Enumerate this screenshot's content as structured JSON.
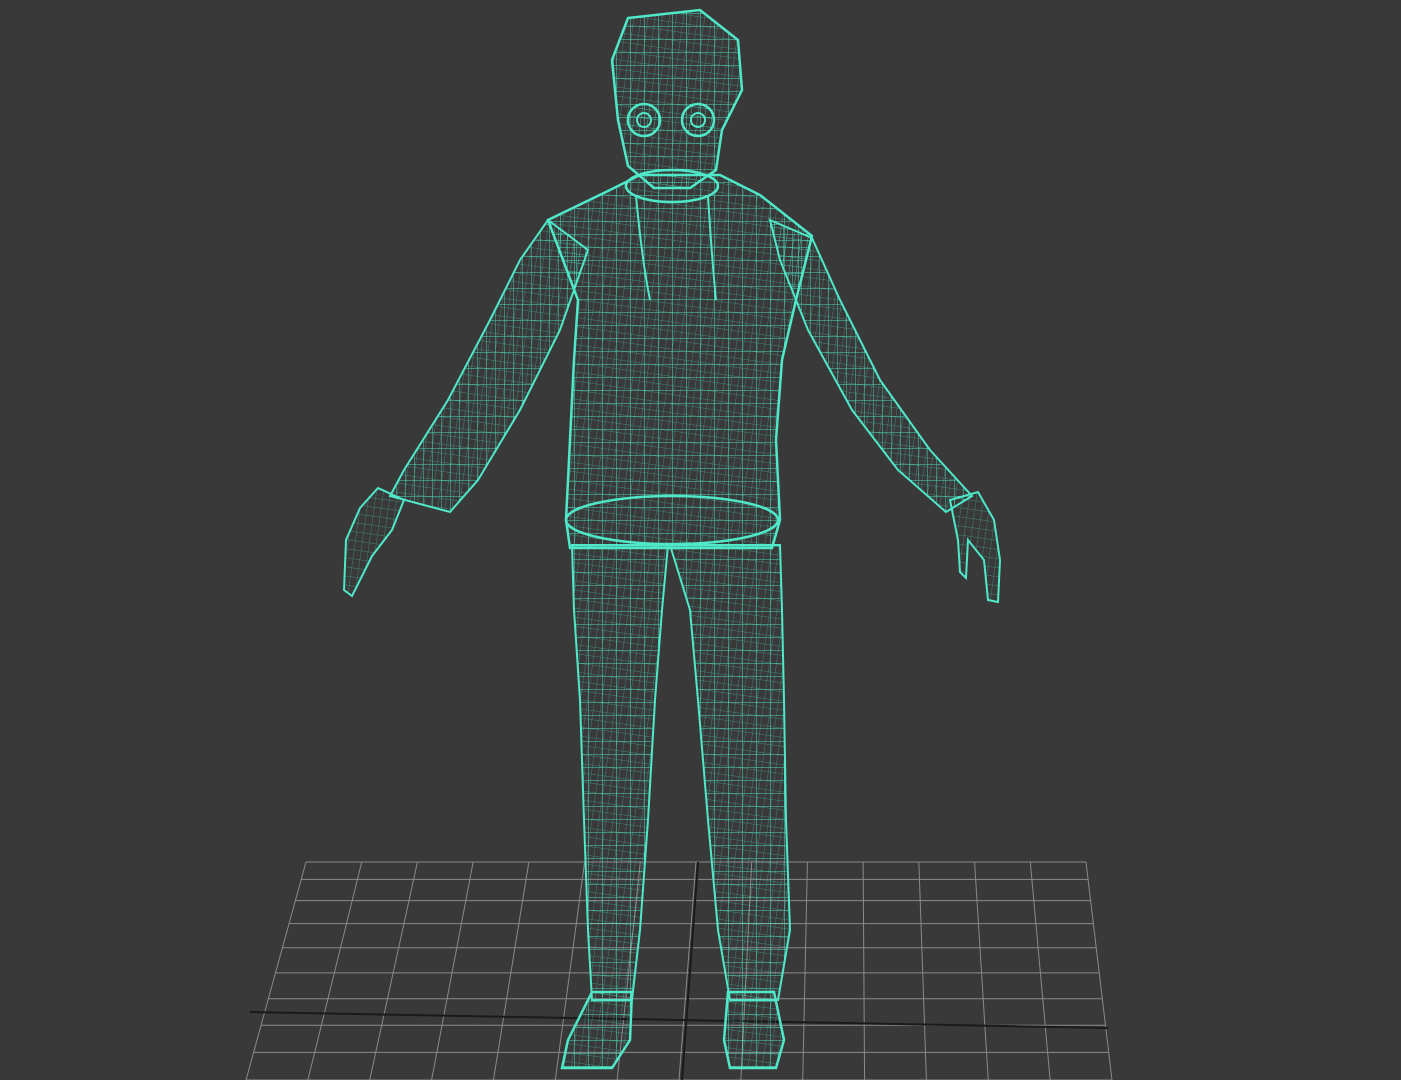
{
  "viewport": {
    "background_color": "#393939",
    "wireframe_color": "#4fe8c8",
    "grid_color": "#8a8a8a",
    "grid_axis_color": "#1a1a1a",
    "shading_mode": "wireframe",
    "model": "character-mesh"
  }
}
